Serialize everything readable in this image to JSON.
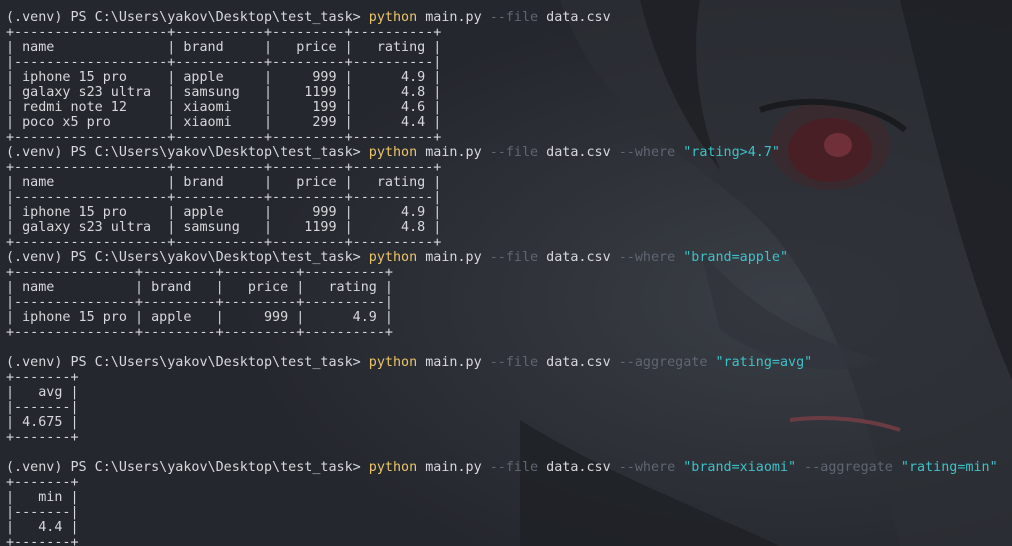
{
  "prompt": "(.venv) PS C:\\Users\\yakov\\Desktop\\test_task> ",
  "commands": [
    {
      "cmd": "python",
      "script": "main.py",
      "tokens": [
        {
          "type": "flag",
          "text": "--file"
        },
        {
          "type": "arg",
          "text": "data.csv"
        }
      ],
      "output": [
        "+-------------------+-----------+---------+----------+",
        "| name              | brand     |   price |   rating |",
        "|-------------------+-----------+---------+----------|",
        "| iphone 15 pro     | apple     |     999 |      4.9 |",
        "| galaxy s23 ultra  | samsung   |    1199 |      4.8 |",
        "| redmi note 12     | xiaomi    |     199 |      4.6 |",
        "| poco x5 pro       | xiaomi    |     299 |      4.4 |",
        "+-------------------+-----------+---------+----------+"
      ]
    },
    {
      "cmd": "python",
      "script": "main.py",
      "tokens": [
        {
          "type": "flag",
          "text": "--file"
        },
        {
          "type": "arg",
          "text": "data.csv"
        },
        {
          "type": "flag",
          "text": "--where"
        },
        {
          "type": "str",
          "text": "\"rating>4.7\""
        }
      ],
      "output": [
        "+-------------------+-----------+---------+----------+",
        "| name              | brand     |   price |   rating |",
        "|-------------------+-----------+---------+----------|",
        "| iphone 15 pro     | apple     |     999 |      4.9 |",
        "| galaxy s23 ultra  | samsung   |    1199 |      4.8 |",
        "+-------------------+-----------+---------+----------+"
      ]
    },
    {
      "cmd": "python",
      "script": "main.py",
      "tokens": [
        {
          "type": "flag",
          "text": "--file"
        },
        {
          "type": "arg",
          "text": "data.csv"
        },
        {
          "type": "flag",
          "text": "--where"
        },
        {
          "type": "str",
          "text": "\"brand=apple\""
        }
      ],
      "output": [
        "+---------------+---------+---------+----------+",
        "| name          | brand   |   price |   rating |",
        "|---------------+---------+---------+----------|",
        "| iphone 15 pro | apple   |     999 |      4.9 |",
        "+---------------+---------+---------+----------+",
        ""
      ]
    },
    {
      "cmd": "python",
      "script": "main.py",
      "tokens": [
        {
          "type": "flag",
          "text": "--file"
        },
        {
          "type": "arg",
          "text": "data.csv"
        },
        {
          "type": "flag",
          "text": "--aggregate"
        },
        {
          "type": "str",
          "text": "\"rating=avg\""
        }
      ],
      "output": [
        "+-------+",
        "|   avg |",
        "|-------|",
        "| 4.675 |",
        "+-------+",
        ""
      ]
    },
    {
      "cmd": "python",
      "script": "main.py",
      "tokens": [
        {
          "type": "flag",
          "text": "--file"
        },
        {
          "type": "arg",
          "text": "data.csv"
        },
        {
          "type": "flag",
          "text": "--where"
        },
        {
          "type": "str",
          "text": "\"brand=xiaomi\""
        },
        {
          "type": "flag",
          "text": "--aggregate"
        },
        {
          "type": "str",
          "text": "\"rating=min\""
        }
      ],
      "output": [
        "+-------+",
        "|   min |",
        "|-------|",
        "|   4.4 |",
        "+-------+"
      ]
    }
  ],
  "colors": {
    "background": "#24272d",
    "text": "#d6d8dc",
    "command": "#e9c46a",
    "flag": "#5f6672",
    "string": "#3fc1c9"
  }
}
